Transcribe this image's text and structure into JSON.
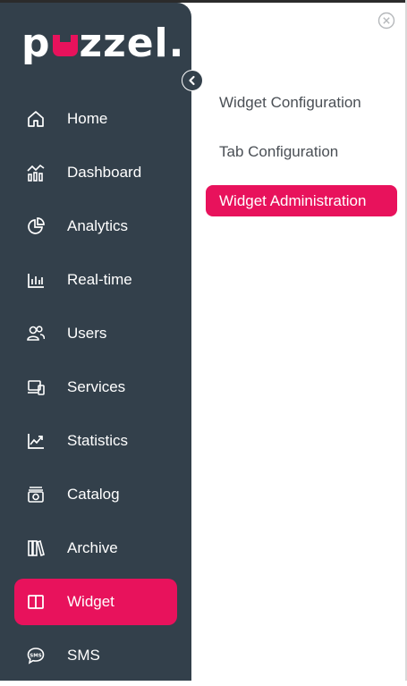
{
  "brand": {
    "logo_left": "p",
    "logo_right": "zzel.",
    "accent": "#e8125c",
    "sidebar_bg": "#33404b"
  },
  "sidebar": {
    "collapse_icon": "chevron-left-icon",
    "items": [
      {
        "label": "Home",
        "icon": "home-icon",
        "active": false
      },
      {
        "label": "Dashboard",
        "icon": "dashboard-icon",
        "active": false
      },
      {
        "label": "Analytics",
        "icon": "pie-chart-icon",
        "active": false
      },
      {
        "label": "Real-time",
        "icon": "bar-chart-icon",
        "active": false
      },
      {
        "label": "Users",
        "icon": "users-icon",
        "active": false
      },
      {
        "label": "Services",
        "icon": "devices-icon",
        "active": false
      },
      {
        "label": "Statistics",
        "icon": "line-chart-icon",
        "active": false
      },
      {
        "label": "Catalog",
        "icon": "catalog-icon",
        "active": false
      },
      {
        "label": "Archive",
        "icon": "archive-icon",
        "active": false
      },
      {
        "label": "Widget",
        "icon": "widget-icon",
        "active": true
      },
      {
        "label": "SMS",
        "icon": "sms-icon",
        "active": false
      }
    ]
  },
  "submenu": {
    "close_icon": "close-circle-icon",
    "items": [
      {
        "label": "Widget Configuration",
        "active": false
      },
      {
        "label": "Tab Configuration",
        "active": false
      },
      {
        "label": "Widget Administration",
        "active": true
      }
    ]
  }
}
